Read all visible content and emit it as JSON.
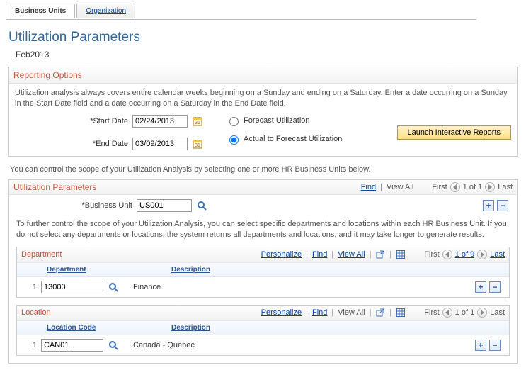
{
  "tabs": {
    "business_units": "Business Units",
    "organization": "Organization"
  },
  "page_title": "Utilization Parameters",
  "period": "Feb2013",
  "reporting": {
    "title": "Reporting Options",
    "help": "Utilization analysis always covers entire calendar weeks beginning on a Sunday and ending on a Saturday. Enter a date occurring on a Sunday in the Start Date field and a date occurring on a Saturday in the End Date field.",
    "start_label": "Start Date",
    "start_value": "02/24/2013",
    "end_label": "End Date",
    "end_value": "03/09/2013",
    "opt_forecast": "Forecast Utilization",
    "opt_actual": "Actual to Forecast Utilization",
    "launch": "Launch Interactive Reports"
  },
  "scope_note": "You can control the scope of your Utilization Analysis by selecting one or more HR Business Units below.",
  "util_grid": {
    "title": "Utilization Parameters",
    "find": "Find",
    "view_all": "View All",
    "first": "First",
    "last": "Last",
    "pager": "1 of 1",
    "bu_label": "Business Unit",
    "bu_value": "US001",
    "note": "To further control the scope of your Utilization Analysis, you can select specific departments and locations within each HR Business Unit. If you do not select any departments or locations, the system returns all departments and locations, and it may take longer to generate results."
  },
  "dept": {
    "title": "Department",
    "personalize": "Personalize",
    "find": "Find",
    "view_all": "View All",
    "first": "First",
    "last": "Last",
    "pager": "1 of 9",
    "col1": "Department",
    "col2": "Description",
    "rownum": "1",
    "value": "13000",
    "desc": "Finance"
  },
  "loc": {
    "title": "Location",
    "personalize": "Personalize",
    "find": "Find",
    "view_all": "View All",
    "first": "First",
    "last": "Last",
    "pager": "1 of 1",
    "col1": "Location Code",
    "col2": "Description",
    "rownum": "1",
    "value": "CAN01",
    "desc": "Canada - Quebec"
  }
}
